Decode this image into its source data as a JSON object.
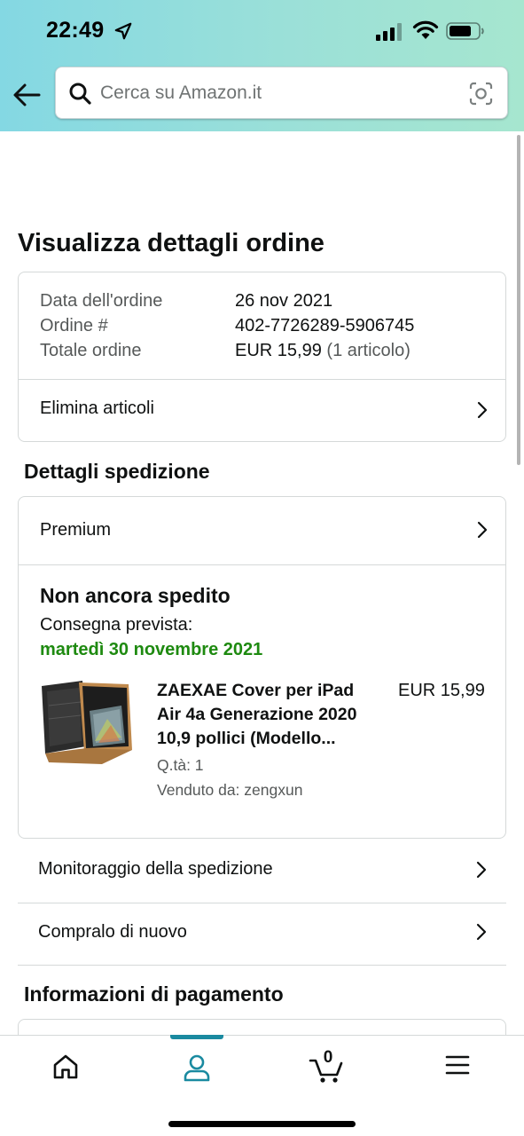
{
  "status_bar": {
    "time": "22:49"
  },
  "search": {
    "placeholder": "Cerca su Amazon.it"
  },
  "page": {
    "title": "Visualizza dettagli ordine"
  },
  "order_summary": {
    "date_label": "Data dell'ordine",
    "date_value": "26 nov 2021",
    "number_label": "Ordine #",
    "number_value": "402-7726289-5906745",
    "total_label": "Totale ordine",
    "total_value": "EUR 15,99",
    "total_items": "(1 articolo)",
    "delete_items_label": "Elimina articoli"
  },
  "shipping": {
    "section_title": "Dettagli spedizione",
    "method_label": "Premium",
    "status": "Non ancora spedito",
    "delivery_label": "Consegna prevista:",
    "delivery_date": "martedì 30 novembre 2021",
    "product": {
      "title": "ZAEXAE Cover per iPad Air 4a Generazione 2020 10,9 pollici (Modello...",
      "price": "EUR 15,99",
      "quantity": "Q.tà: 1",
      "seller": "Venduto da: zengxun"
    }
  },
  "actions": {
    "track_label": "Monitoraggio della spedizione",
    "buy_again_label": "Compralo di nuovo"
  },
  "payment": {
    "section_title": "Informazioni di pagamento"
  },
  "bottom_nav": {
    "cart_count": "0",
    "active_tab": "account"
  },
  "colors": {
    "accent_teal": "#1a8aa0",
    "delivery_green": "#1e8a10",
    "header_gradient_start": "#84d8e3",
    "header_gradient_end": "#a6e6cf"
  }
}
